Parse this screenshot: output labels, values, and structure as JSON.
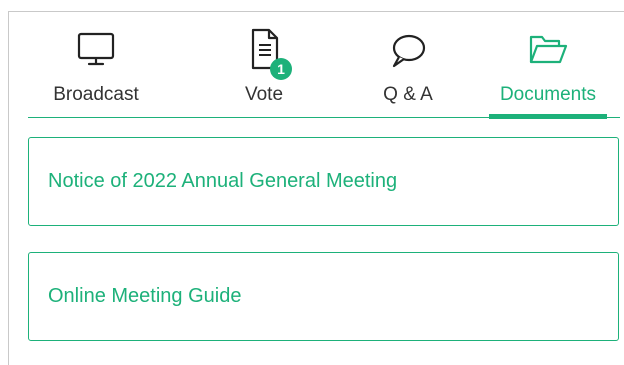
{
  "tabs": [
    {
      "label": "Broadcast",
      "icon": "monitor-icon",
      "active": false
    },
    {
      "label": "Vote",
      "icon": "document-icon",
      "badge": "1",
      "active": false
    },
    {
      "label": "Q & A",
      "icon": "speech-bubble-icon",
      "active": false
    },
    {
      "label": "Documents",
      "icon": "folder-open-icon",
      "active": true
    }
  ],
  "documents": [
    {
      "title": "Notice of 2022 Annual General Meeting"
    },
    {
      "title": "Online Meeting Guide"
    }
  ],
  "colors": {
    "accent": "#1db17a",
    "text": "#333333",
    "border": "#c9c9c9"
  }
}
